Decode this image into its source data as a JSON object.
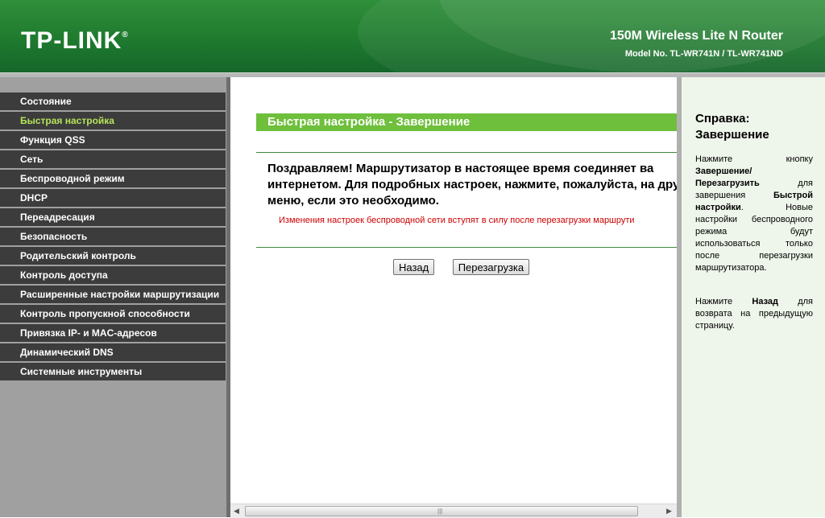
{
  "header": {
    "logo": "TP-LINK",
    "logo_mark": "®",
    "product_name": "150M Wireless Lite N Router",
    "model": "Model No. TL-WR741N / TL-WR741ND",
    "header_color": "#1f7a2e"
  },
  "sidebar": {
    "items": [
      {
        "label": "Состояние"
      },
      {
        "label": "Быстрая настройка",
        "active": true
      },
      {
        "label": "Функция QSS"
      },
      {
        "label": "Сеть"
      },
      {
        "label": "Беспроводной режим"
      },
      {
        "label": "DHCP"
      },
      {
        "label": "Переадресация"
      },
      {
        "label": "Безопасность"
      },
      {
        "label": "Родительский контроль"
      },
      {
        "label": "Контроль доступа"
      },
      {
        "label": "Расширенные настройки маршрутизации"
      },
      {
        "label": "Контроль пропускной способности"
      },
      {
        "label": "Привязка IP- и MAC-адресов"
      },
      {
        "label": "Динамический DNS"
      },
      {
        "label": "Системные инструменты"
      }
    ],
    "active_color": "#b5e35a"
  },
  "main": {
    "title": "Быстрая настройка - Завершение",
    "congrats": "Поздравляем! Маршрутизатор в настоящее время соединяет ва интернетом. Для подробных настроек, нажмите, пожалуйста, на другие меню, если это необходимо.",
    "note": "Изменения настроек беспроводной сети вступят в силу после перезагрузки маршрути",
    "buttons": {
      "back": "Назад",
      "reboot": "Перезагрузка"
    },
    "title_bar_color": "#6ebf3b"
  },
  "scrollbar": {
    "left_arrow_icon": "triangle-left-icon",
    "right_arrow_icon": "triangle-right-icon",
    "grip_icon": "grip-icon"
  },
  "help": {
    "title_line1": "Справка:",
    "title_line2": "Завершение",
    "p1_pre": "Нажмите кнопку ",
    "p1_bold1": "Завершение/ Перезагрузить",
    "p1_mid": " для завершения ",
    "p1_bold2": "Быстрой настройки",
    "p1_post": ". Новые настройки беспроводного режима будут использоваться только после перезагрузки маршрутизатора.",
    "p2_pre": "Нажмите ",
    "p2_bold": "Назад",
    "p2_post": " для возврата на предыдущую страницу."
  }
}
